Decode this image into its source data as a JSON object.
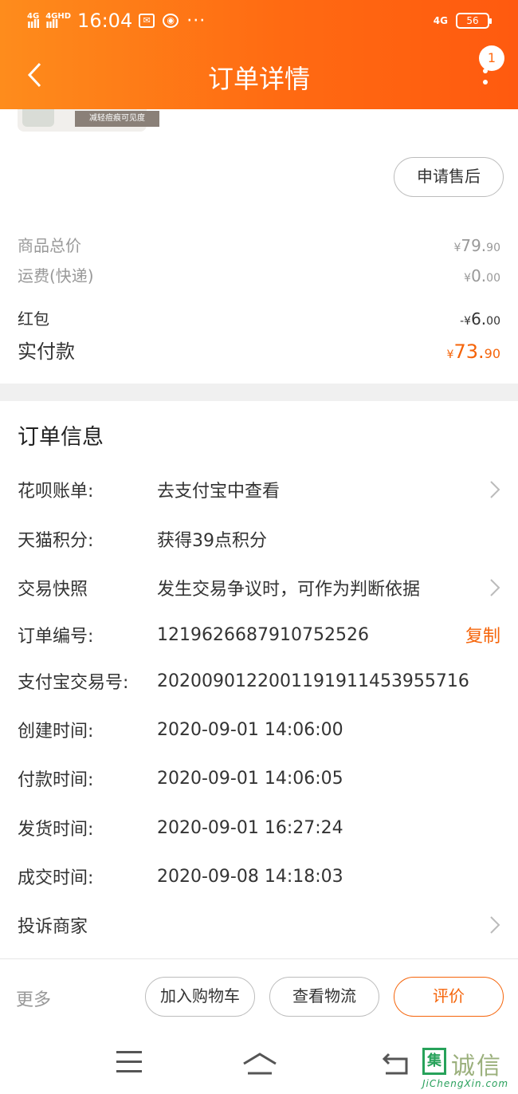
{
  "status_bar": {
    "net1": "4G",
    "net2": "4GHD",
    "time": "16:04",
    "net_right": "4G",
    "battery": "56"
  },
  "header": {
    "title": "订单详情",
    "badge_count": "1"
  },
  "product": {
    "tag_text": "减轻痘痕可见度"
  },
  "after_sale_button": "申请售后",
  "prices": {
    "goods_total": {
      "label": "商品总价",
      "yen": "¥",
      "int": "79.",
      "dec": "90"
    },
    "shipping": {
      "label": "运费(快递)",
      "yen": "¥",
      "int": "0.",
      "dec": "00"
    },
    "red_packet": {
      "label": "红包",
      "yen": "-¥",
      "int": "6.",
      "dec": "00"
    },
    "paid": {
      "label": "实付款",
      "yen": "¥",
      "int": "73.",
      "dec": "90"
    }
  },
  "order_info": {
    "title": "订单信息",
    "rows": [
      {
        "key": "花呗账单:",
        "value": "去支付宝中查看"
      },
      {
        "key": "天猫积分:",
        "value": "获得39点积分"
      },
      {
        "key": "交易快照",
        "value": "发生交易争议时，可作为判断依据"
      },
      {
        "key": "订单编号:",
        "value": "1219626687910752526"
      },
      {
        "key": "支付宝交易号:",
        "value": "2020090122001191911453955716"
      },
      {
        "key": "创建时间:",
        "value": "2020-09-01 14:06:00"
      },
      {
        "key": "付款时间:",
        "value": "2020-09-01 14:06:05"
      },
      {
        "key": "发货时间:",
        "value": "2020-09-01 16:27:24"
      },
      {
        "key": "成交时间:",
        "value": "2020-09-08 14:18:03"
      },
      {
        "key": "投诉商家",
        "value": ""
      }
    ],
    "copy_label": "复制"
  },
  "bottom_bar": {
    "more": "更多",
    "add_cart": "加入购物车",
    "view_logistics": "查看物流",
    "evaluate": "评价"
  },
  "watermark": {
    "char": "集",
    "text": "诚信",
    "url": "JiChengXin.com"
  },
  "colors": {
    "accent": "#f5640a",
    "header_start": "#fe8c1c",
    "header_end": "#ff5a0f"
  }
}
